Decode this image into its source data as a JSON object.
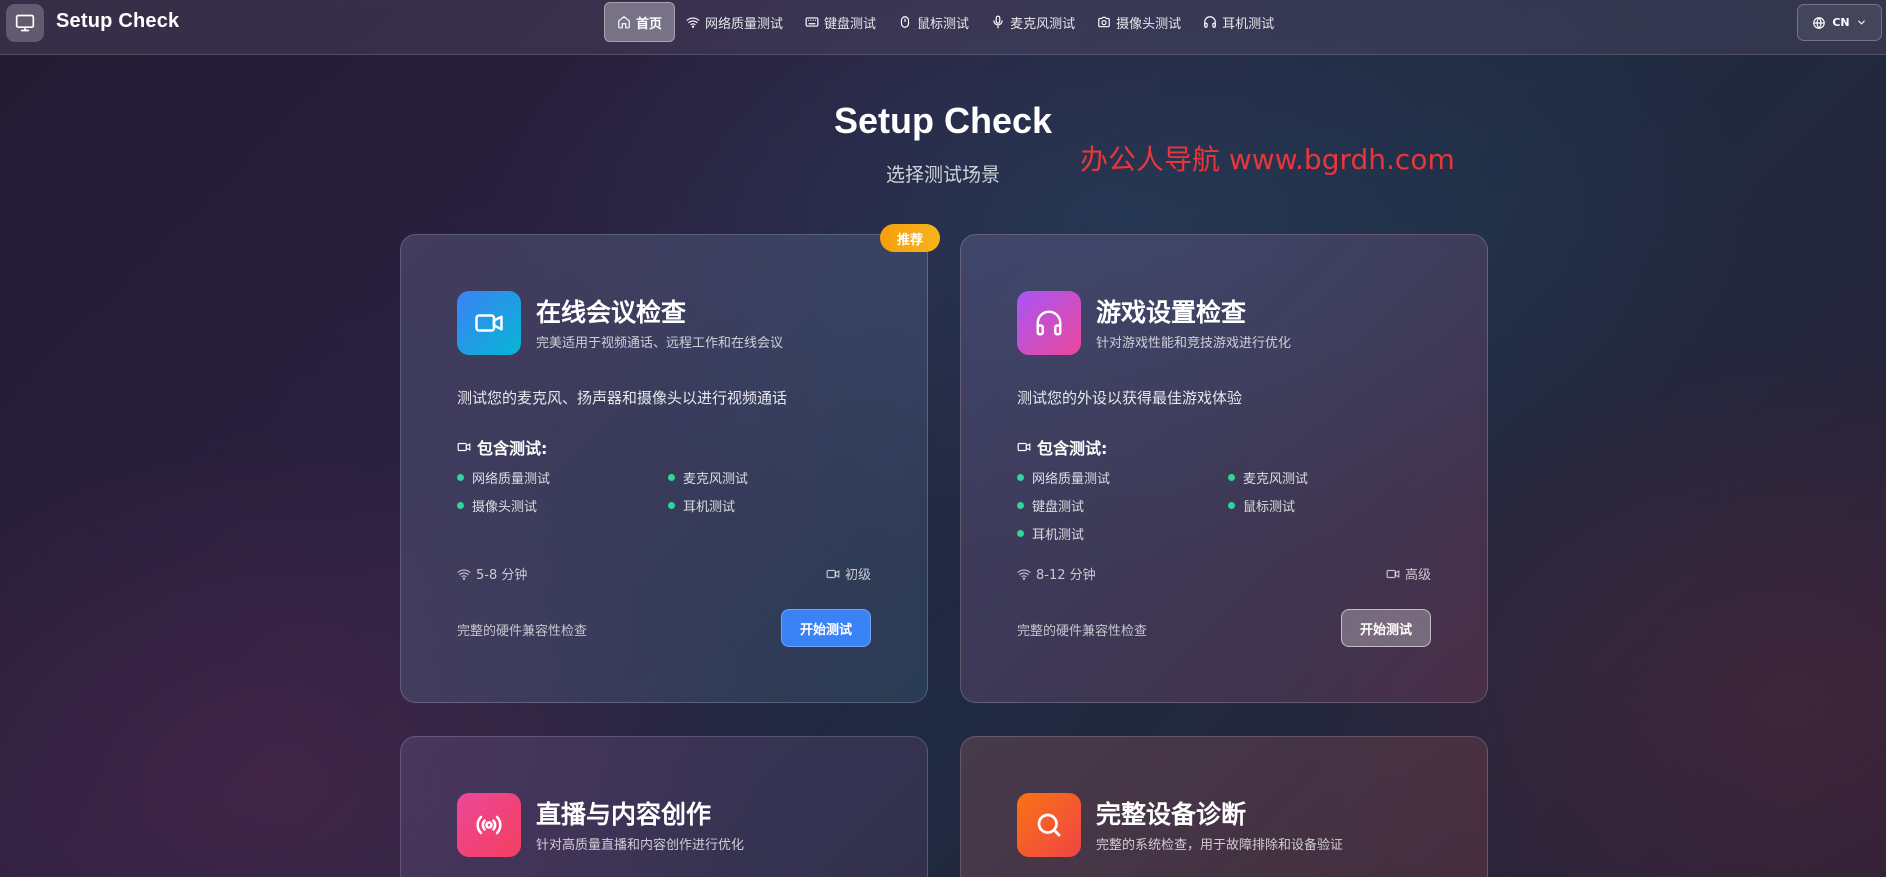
{
  "header": {
    "brand": "Setup Check",
    "nav": [
      {
        "label": "首页",
        "icon": "home-icon"
      },
      {
        "label": "网络质量测试",
        "icon": "wifi-icon"
      },
      {
        "label": "键盘测试",
        "icon": "keyboard-icon"
      },
      {
        "label": "鼠标测试",
        "icon": "mouse-icon"
      },
      {
        "label": "麦克风测试",
        "icon": "mic-icon"
      },
      {
        "label": "摄像头测试",
        "icon": "camera-icon"
      },
      {
        "label": "耳机测试",
        "icon": "headphones-icon"
      }
    ],
    "lang": "CN"
  },
  "hero": {
    "title": "Setup Check",
    "subtitle": "选择测试场景",
    "watermark": "办公人导航 www.bgrdh.com"
  },
  "cards": [
    {
      "badge": "推荐",
      "title": "在线会议检查",
      "subtitle": "完美适用于视频通话、远程工作和在线会议",
      "description": "测试您的麦克风、扬声器和摄像头以进行视频通话",
      "included_label": "包含测试:",
      "tests": [
        "网络质量测试",
        "麦克风测试",
        "摄像头测试",
        "耳机测试"
      ],
      "duration": "5-8 分钟",
      "level": "初级",
      "footer": "完整的硬件兼容性检查",
      "button": "开始测试",
      "icon": "video-icon",
      "icon_gradient": [
        "#3b82f6",
        "#06b6d4"
      ]
    },
    {
      "title": "游戏设置检查",
      "subtitle": "针对游戏性能和竞技游戏进行优化",
      "description": "测试您的外设以获得最佳游戏体验",
      "included_label": "包含测试:",
      "tests": [
        "网络质量测试",
        "麦克风测试",
        "键盘测试",
        "鼠标测试",
        "耳机测试"
      ],
      "duration": "8-12 分钟",
      "level": "高级",
      "footer": "完整的硬件兼容性检查",
      "button": "开始测试",
      "icon": "headphones-icon",
      "icon_gradient": [
        "#a855f7",
        "#ec4899"
      ]
    },
    {
      "title": "直播与内容创作",
      "subtitle": "针对高质量直播和内容创作进行优化",
      "icon": "broadcast-icon",
      "icon_gradient": [
        "#ec4899",
        "#f43f5e"
      ]
    },
    {
      "title": "完整设备诊断",
      "subtitle": "完整的系统检查，用于故障排除和设备验证",
      "icon": "search-icon",
      "icon_gradient": [
        "#f97316",
        "#ef4444"
      ]
    }
  ]
}
